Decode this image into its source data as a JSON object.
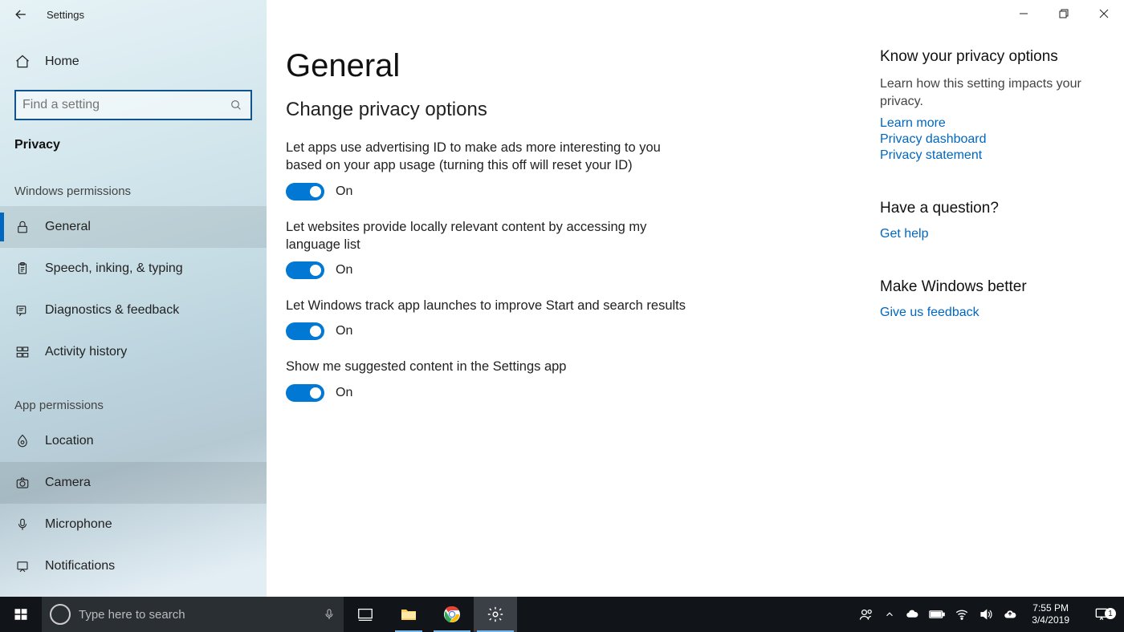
{
  "window": {
    "app_title": "Settings"
  },
  "sidebar": {
    "home": "Home",
    "search_placeholder": "Find a setting",
    "category": "Privacy",
    "sections": [
      {
        "heading": "Windows permissions",
        "items": [
          {
            "label": "General",
            "active": true
          },
          {
            "label": "Speech, inking, & typing"
          },
          {
            "label": "Diagnostics & feedback"
          },
          {
            "label": "Activity history"
          }
        ]
      },
      {
        "heading": "App permissions",
        "items": [
          {
            "label": "Location"
          },
          {
            "label": "Camera",
            "hovered": true
          },
          {
            "label": "Microphone"
          },
          {
            "label": "Notifications"
          }
        ]
      }
    ]
  },
  "main": {
    "title": "General",
    "subheading": "Change privacy options",
    "options": [
      {
        "desc": "Let apps use advertising ID to make ads more interesting to you based on your app usage (turning this off will reset your ID)",
        "state": "On"
      },
      {
        "desc": "Let websites provide locally relevant content by accessing my language list",
        "state": "On"
      },
      {
        "desc": "Let Windows track app launches to improve Start and search results",
        "state": "On"
      },
      {
        "desc": "Show me suggested content in the Settings app",
        "state": "On"
      }
    ],
    "side": {
      "block1_heading": "Know your privacy options",
      "block1_text": "Learn how this setting impacts your privacy.",
      "block1_links": [
        "Learn more",
        "Privacy dashboard",
        "Privacy statement"
      ],
      "block2_heading": "Have a question?",
      "block2_link": "Get help",
      "block3_heading": "Make Windows better",
      "block3_link": "Give us feedback"
    }
  },
  "taskbar": {
    "search_placeholder": "Type here to search",
    "time": "7:55 PM",
    "date": "3/4/2019",
    "notif_count": "1"
  }
}
